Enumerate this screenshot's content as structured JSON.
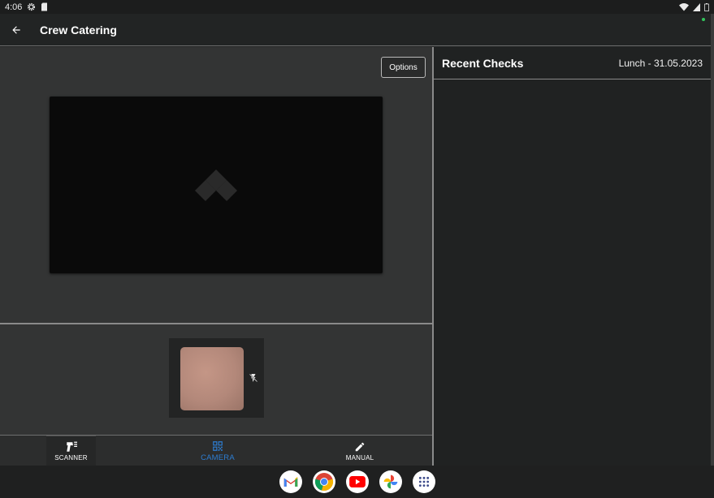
{
  "status_bar": {
    "time": "4:06",
    "left_icons": [
      "settings-gear-icon",
      "sd-card-icon"
    ],
    "right_icons": [
      "wifi-icon",
      "signal-icon",
      "battery-icon"
    ]
  },
  "app_bar": {
    "title": "Crew Catering",
    "back_icon": "arrow-left-icon"
  },
  "scanner_pane": {
    "options_label": "Options",
    "camera_placeholder_icon": "scandit-logo-icon",
    "flash_icon": "flash-off-icon"
  },
  "recent_checks": {
    "title": "Recent Checks",
    "meal": "Lunch  - 31.05.2023",
    "items": []
  },
  "bottom_nav": {
    "items": [
      {
        "label": "SCANNER",
        "icon": "barcode-scanner-gun-icon",
        "active": false
      },
      {
        "label": "CAMERA",
        "icon": "qr-code-icon",
        "active": true
      },
      {
        "label": "MANUAL",
        "icon": "pencil-icon",
        "active": false
      }
    ]
  },
  "taskbar": {
    "apps": [
      "gmail-icon",
      "chrome-icon",
      "youtube-icon",
      "photos-icon",
      "app-drawer-icon"
    ]
  },
  "colors": {
    "accent": "#2d7dd2",
    "background": "#202222",
    "pane": "#333434"
  }
}
